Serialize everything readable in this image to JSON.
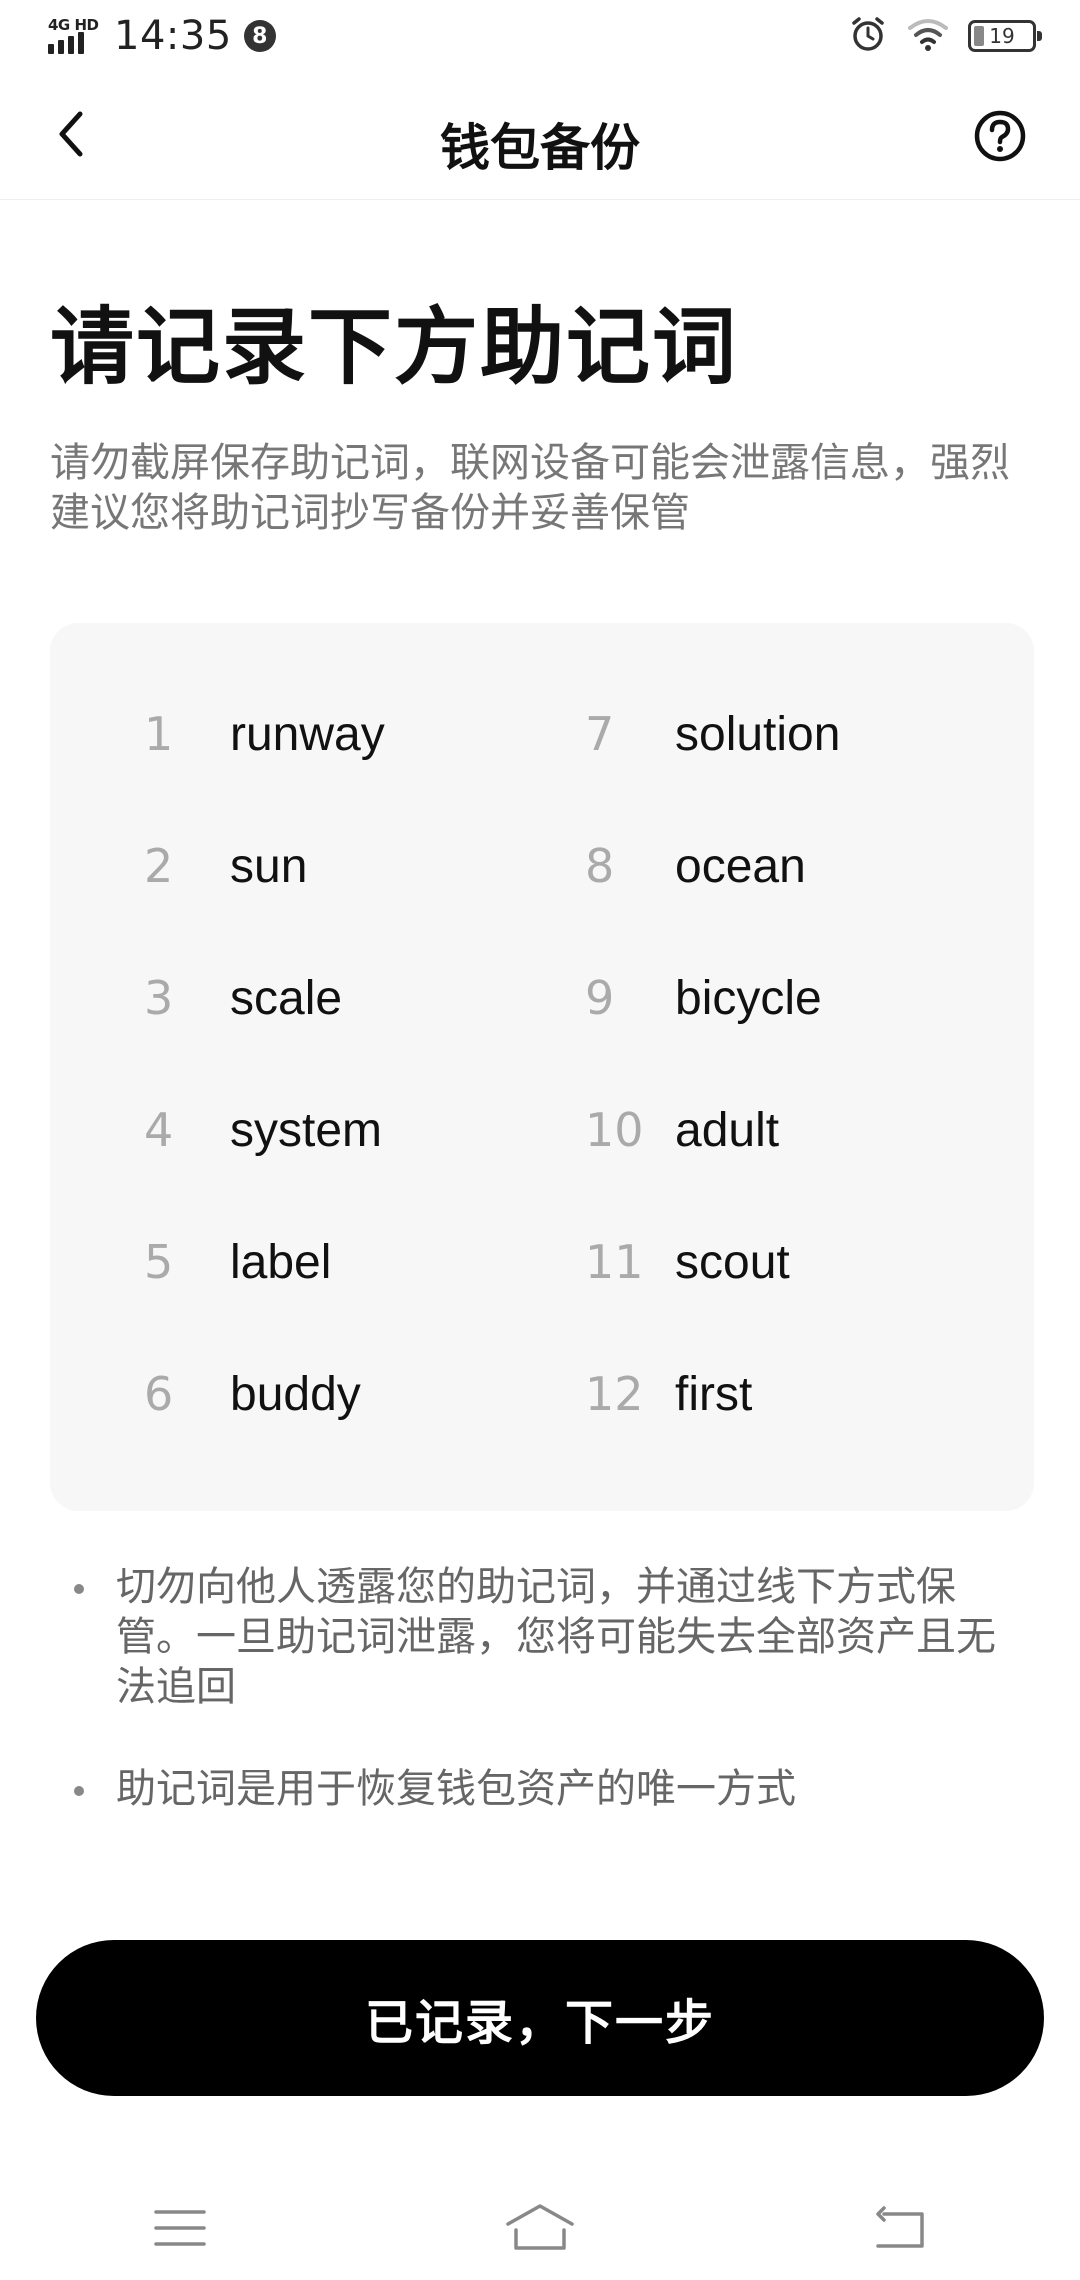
{
  "status_bar": {
    "network": "4G HD",
    "time": "14:35",
    "notification_badge": "8",
    "battery_level": "19"
  },
  "header": {
    "title": "钱包备份",
    "back_icon": "chevron-left-icon",
    "help_icon": "question-circle-icon"
  },
  "main": {
    "title": "请记录下方助记词",
    "description": "请勿截屏保存助记词，联网设备可能会泄露信息，强烈建议您将助记词抄写备份并妥善保管"
  },
  "mnemonic": {
    "left": [
      {
        "num": "1",
        "word": "runway"
      },
      {
        "num": "2",
        "word": "sun"
      },
      {
        "num": "3",
        "word": "scale"
      },
      {
        "num": "4",
        "word": "system"
      },
      {
        "num": "5",
        "word": "label"
      },
      {
        "num": "6",
        "word": "buddy"
      }
    ],
    "right": [
      {
        "num": "7",
        "word": "solution"
      },
      {
        "num": "8",
        "word": "ocean"
      },
      {
        "num": "9",
        "word": "bicycle"
      },
      {
        "num": "10",
        "word": "adult"
      },
      {
        "num": "11",
        "word": "scout"
      },
      {
        "num": "12",
        "word": "first"
      }
    ]
  },
  "tips": [
    "切勿向他人透露您的助记词，并通过线下方式保管。一旦助记词泄露，您将可能失去全部资产且无法追回",
    "助记词是用于恢复钱包资产的唯一方式"
  ],
  "actions": {
    "next_label": "已记录，下一步"
  },
  "nav_bar": {
    "icons": [
      "menu-icon",
      "home-icon",
      "back-icon"
    ]
  },
  "colors": {
    "card_background": "#f7f7f7",
    "button_background": "#000000",
    "muted_text": "#777777",
    "index_text": "#aaaaaa"
  }
}
